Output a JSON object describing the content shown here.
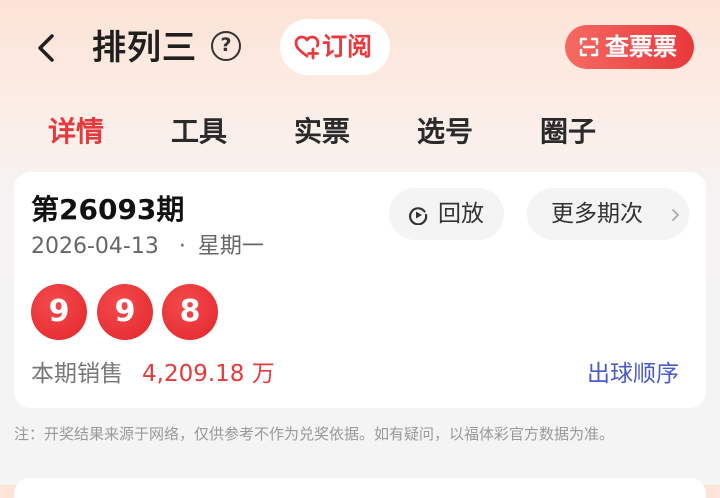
{
  "header": {
    "title": "排列三",
    "back_icon": "chevron-left-icon",
    "help_icon_glyph": "?",
    "subscribe": {
      "label": "订阅",
      "icon": "heart-plus-icon"
    },
    "check_ticket": {
      "label": "查票票",
      "icon": "scan-icon"
    }
  },
  "tabs": [
    {
      "label": "详情",
      "active": true
    },
    {
      "label": "工具",
      "active": false
    },
    {
      "label": "实票",
      "active": false
    },
    {
      "label": "选号",
      "active": false
    },
    {
      "label": "圈子",
      "active": false
    }
  ],
  "draw": {
    "issue": "第26093期",
    "date": "2026-04-13",
    "separator": "·",
    "weekday": "星期一",
    "replay_label": "回放",
    "more_label": "更多期次",
    "balls": [
      "9",
      "9",
      "8"
    ],
    "sales_label": "本期销售",
    "sales_value": "4,209.18 万",
    "order_link": "出球顺序"
  },
  "note": "注：开奖结果来源于网络，仅供参考不作为兑奖依据。如有疑问，以福体彩官方数据为准。",
  "colors": {
    "accent": "#e5393c",
    "link": "#4a5bc7"
  }
}
